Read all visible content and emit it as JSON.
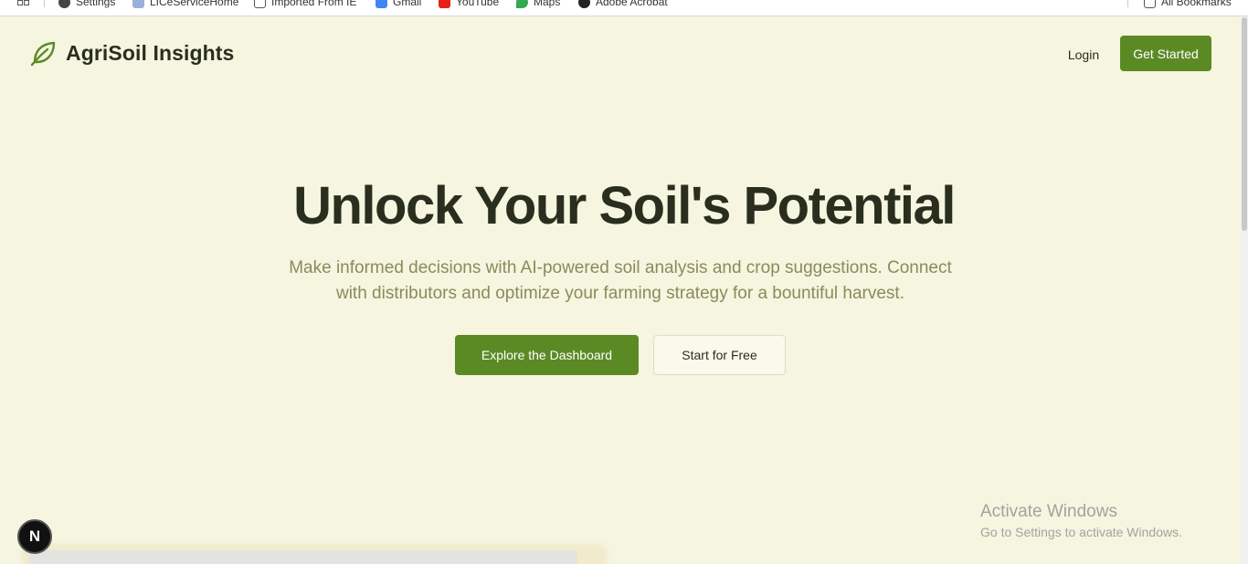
{
  "bookmarks": {
    "items": [
      {
        "label": "Settings",
        "icon": "gear-icon"
      },
      {
        "label": "LICeServiceHome",
        "icon": "lic-icon"
      },
      {
        "label": "Imported From IE",
        "icon": "folder-icon"
      },
      {
        "label": "Gmail",
        "icon": "gmail-icon"
      },
      {
        "label": "YouTube",
        "icon": "youtube-icon"
      },
      {
        "label": "Maps",
        "icon": "maps-icon"
      },
      {
        "label": "Adobe Acrobat",
        "icon": "acrobat-icon"
      }
    ],
    "all_bookmarks": "All Bookmarks"
  },
  "header": {
    "brand": "AgriSoil Insights",
    "login_label": "Login",
    "get_started_label": "Get Started"
  },
  "hero": {
    "title": "Unlock Your Soil's Potential",
    "subtitle": "Make informed decisions with AI-powered soil analysis and crop suggestions. Connect with distributors and optimize your farming strategy for a bountiful harvest.",
    "primary_cta": "Explore the Dashboard",
    "secondary_cta": "Start for Free"
  },
  "next_badge": {
    "label": "N"
  },
  "windows_watermark": {
    "title": "Activate Windows",
    "subtitle": "Go to Settings to activate Windows."
  },
  "colors": {
    "background": "#f5f5e0",
    "accent": "#5b8a25",
    "text": "#2a2e1f",
    "muted": "#8a8b5c"
  }
}
